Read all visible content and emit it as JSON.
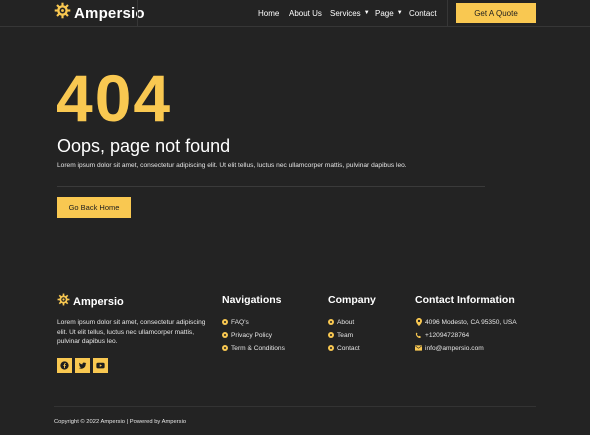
{
  "header": {
    "brand": "Ampersio",
    "nav": [
      {
        "label": "Home"
      },
      {
        "label": "About Us"
      },
      {
        "label": "Services"
      },
      {
        "label": "Page"
      },
      {
        "label": "Contact"
      }
    ],
    "cta_label": "Get A Quote"
  },
  "error": {
    "code": "404",
    "headline": "Oops, page not found",
    "description": "Lorem ipsum dolor sit amet, consectetur adipiscing elit. Ut elit tellus, luctus nec ullamcorper mattis, pulvinar dapibus leo.",
    "button_label": "Go Back Home"
  },
  "footer": {
    "brand": "Ampersio",
    "about": "Lorem ipsum dolor sit amet, consectetur adipiscing elit. Ut elit tellus, luctus nec ullamcorper mattis, pulvinar dapibus leo.",
    "social_icons": [
      "facebook-icon",
      "twitter-icon",
      "youtube-icon"
    ],
    "navigations": {
      "title": "Navigations",
      "items": [
        "FAQ's",
        "Privacy Policy",
        "Term & Conditions"
      ]
    },
    "company": {
      "title": "Company",
      "items": [
        "About",
        "Team",
        "Contact"
      ]
    },
    "contact": {
      "title": "Contact Information",
      "address": "4096 Modesto, CA 95350, USA",
      "phone": "+12094728764",
      "email": "info@ampersio.com"
    },
    "copyright": "Copyright © 2022 Ampersio | Powered by Ampersio"
  },
  "colors": {
    "background": "#232323",
    "accent": "#f9c851",
    "text": "#ffffff"
  }
}
